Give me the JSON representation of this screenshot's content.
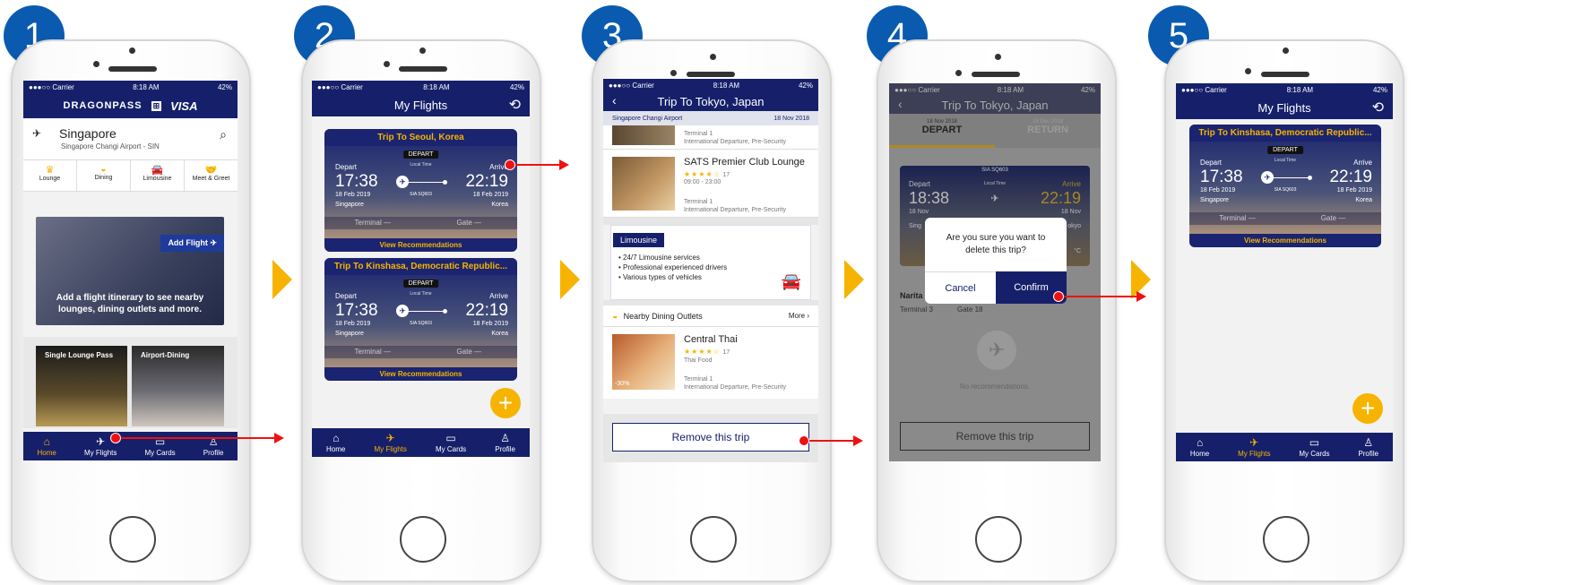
{
  "steps": [
    "1",
    "2",
    "3",
    "4",
    "5"
  ],
  "status": {
    "carrier": "●●●○○ Carrier",
    "time": "8:18 AM",
    "battery": "42%"
  },
  "tabs": {
    "home": "Home",
    "flights": "My Flights",
    "cards": "My Cards",
    "profile": "Profile"
  },
  "screen1": {
    "brand": "DRAGONPASS",
    "visa": "VISA",
    "city": "Singapore",
    "airport": "Singapore Changi Airport - SIN",
    "services": [
      "Lounge",
      "Dining",
      "Limousine",
      "Meet & Greet"
    ],
    "add_flight": "Add Flight",
    "promo_text": "Add a flight itinerary to see nearby lounges, dining outlets and more.",
    "tile1": "Single Lounge Pass",
    "tile2": "Airport-Dining"
  },
  "screen2": {
    "title": "My Flights",
    "trips": [
      {
        "title": "Trip To Seoul, Korea",
        "depart_badge": "DEPART",
        "local_time": "Local Time",
        "depart_label": "Depart",
        "arrive_label": "Arrive",
        "dep_time": "17:38",
        "arr_time": "22:19",
        "dep_date": "18 Feb 2019",
        "arr_date": "18 Feb 2019",
        "dep_city": "Singapore",
        "arr_city": "Korea",
        "flight_no": "SIA SQ603",
        "terminal": "Terminal  —",
        "gate": "Gate  —",
        "rec": "View Recommendations"
      },
      {
        "title": "Trip To Kinshasa, Democratic Republic...",
        "depart_badge": "DEPART",
        "local_time": "Local Time",
        "depart_label": "Depart",
        "arrive_label": "Arrive",
        "dep_time": "17:38",
        "arr_time": "22:19",
        "dep_date": "18 Feb 2019",
        "arr_date": "18 Feb 2019",
        "dep_city": "Singapore",
        "arr_city": "Korea",
        "flight_no": "SIA SQ603",
        "terminal": "Terminal  —",
        "gate": "Gate  —",
        "rec": "View Recommendations"
      }
    ],
    "fab": "+"
  },
  "screen3": {
    "title": "Trip To Tokyo, Japan",
    "airport": "Singapore Changi Airport",
    "date": "18 Nov 2018",
    "item0_term": "Terminal 1",
    "item0_desc": "International Departure, Pre-Security",
    "lounge_name": "SATS Premier Club Lounge",
    "lounge_rating": "17",
    "lounge_hours": "09:00 - 23:00",
    "lounge_term": "Terminal 1",
    "lounge_desc": "International Departure, Pre-Security",
    "limo_title": "Limousine",
    "limo_points": [
      "24/7 Limousine services",
      "Professional experienced drivers",
      "Various types of vehicles"
    ],
    "dining_header": "Nearby Dining Outlets",
    "more": "More",
    "dining_name": "Central Thai",
    "dining_rating": "17",
    "dining_type": "Thai Food",
    "dining_badge": "-30%",
    "dining_term": "Terminal 1",
    "dining_desc": "International Departure, Pre-Security",
    "remove": "Remove this trip"
  },
  "screen4": {
    "title": "Trip To Tokyo, Japan",
    "dep_date": "18 Nov 2018",
    "depart_tab": "DEPART",
    "ret_date": "18 Dec 2018",
    "return_tab": "RETURN",
    "flight_no": "SIA SQ603",
    "depart_label": "Depart",
    "arrive_label": "Arrive",
    "local_time": "Local Time",
    "dep_time": "18:38",
    "arr_time": "22:19",
    "dep_date2": "18 Nov",
    "arr_date2": "18 Nov",
    "dep_city": "Sing",
    "arr_city": "okyo",
    "temp": "°C",
    "nari": "Narita",
    "term3": "Terminal 3",
    "gate18": "Gate 18",
    "no_rec": "No recommendations.",
    "remove": "Remove this trip",
    "dialog_text": "Are you sure you want to delete this trip?",
    "cancel": "Cancel",
    "confirm": "Confirm"
  },
  "screen5": {
    "title": "My Flights",
    "trip": {
      "title": "Trip To Kinshasa, Democratic Republic...",
      "depart_badge": "DEPART",
      "local_time": "Local Time",
      "depart_label": "Depart",
      "arrive_label": "Arrive",
      "dep_time": "17:38",
      "arr_time": "22:19",
      "dep_date": "18 Feb 2019",
      "arr_date": "18 Feb 2019",
      "dep_city": "Singapore",
      "arr_city": "Korea",
      "flight_no": "SIA SQ603",
      "terminal": "Terminal  —",
      "gate": "Gate  —",
      "rec": "View Recommendations"
    },
    "fab": "+"
  },
  "colors": {
    "navy": "#16206a",
    "gold": "#f6b400",
    "step_blue": "#0a5bb0",
    "arrow_red": "#ee1111"
  }
}
